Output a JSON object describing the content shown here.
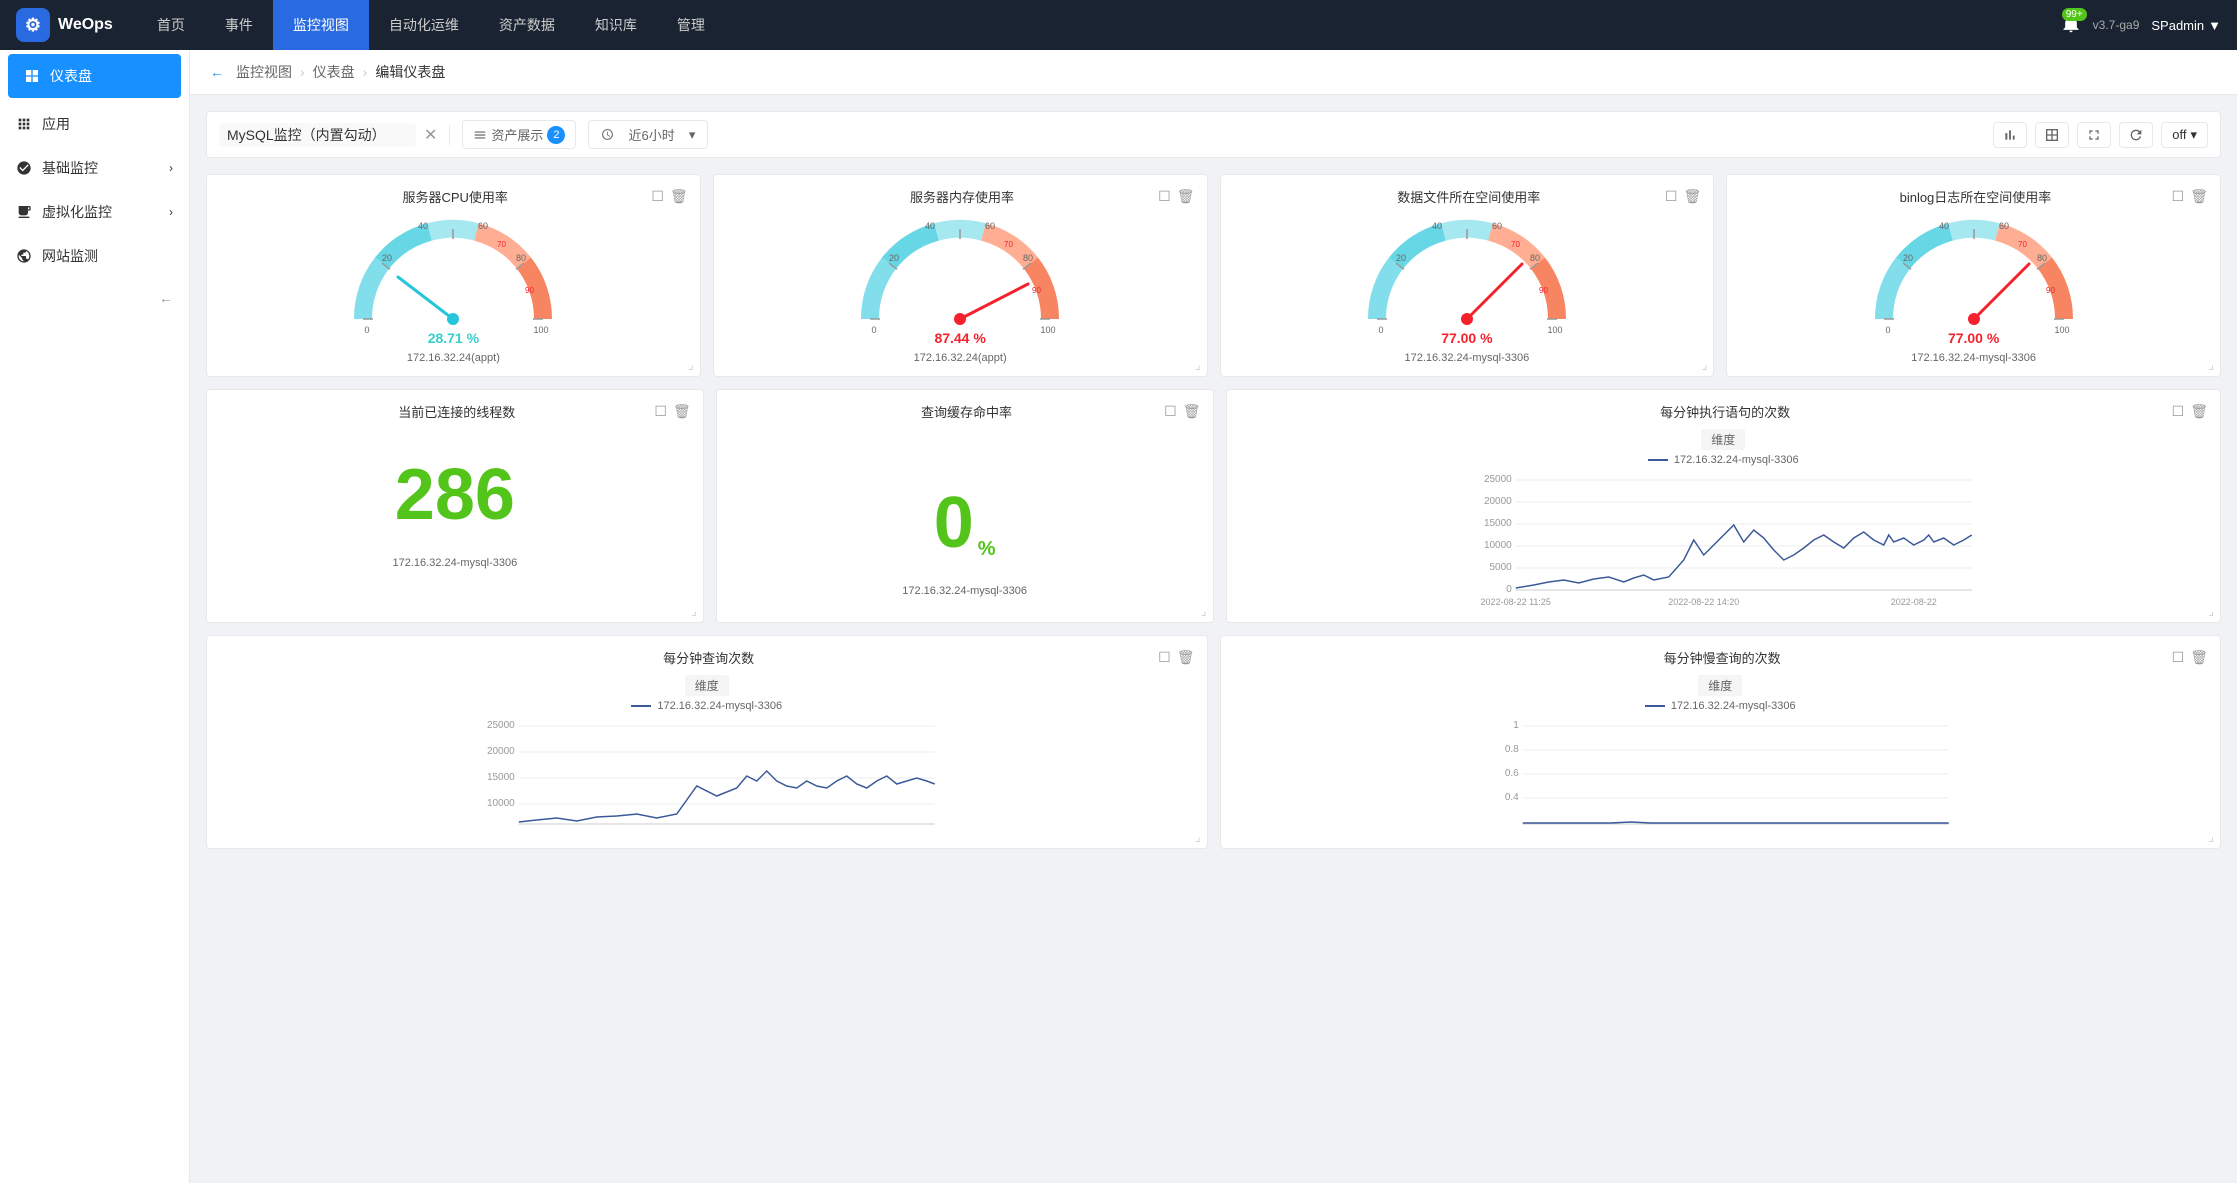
{
  "app": {
    "name": "WeOps",
    "version": "v3.7-ga9",
    "user": "SPadmin",
    "notification_count": "99+"
  },
  "nav": {
    "items": [
      {
        "label": "首页",
        "active": false
      },
      {
        "label": "事件",
        "active": false
      },
      {
        "label": "监控视图",
        "active": true
      },
      {
        "label": "自动化运维",
        "active": false
      },
      {
        "label": "资产数据",
        "active": false
      },
      {
        "label": "知识库",
        "active": false
      },
      {
        "label": "管理",
        "active": false
      }
    ]
  },
  "sidebar": {
    "items": [
      {
        "label": "仪表盘",
        "icon": "dashboard",
        "active": true
      },
      {
        "label": "应用",
        "icon": "app",
        "active": false
      },
      {
        "label": "基础监控",
        "icon": "monitor",
        "active": false,
        "has_children": true
      },
      {
        "label": "虚拟化监控",
        "icon": "virtual",
        "active": false,
        "has_children": true
      },
      {
        "label": "网站监测",
        "icon": "website",
        "active": false
      }
    ]
  },
  "breadcrumb": {
    "items": [
      "监控视图",
      "仪表盘",
      "编辑仪表盘"
    ]
  },
  "toolbar": {
    "dashboard_name": "MySQL监控（内置勾动）",
    "asset_label": "资产展示",
    "asset_count": "2",
    "time_range": "近6小时",
    "off_label": "off"
  },
  "widgets": {
    "row1": [
      {
        "title": "服务器CPU使用率",
        "type": "gauge",
        "value": "28.71 %",
        "value_color": "cyan",
        "server": "172.16.32.24(appt)",
        "gauge_pct": 28.71
      },
      {
        "title": "服务器内存使用率",
        "type": "gauge",
        "value": "87.44 %",
        "value_color": "red",
        "server": "172.16.32.24(appt)",
        "gauge_pct": 87.44
      },
      {
        "title": "数据文件所在空间使用率",
        "type": "gauge",
        "value": "77.00 %",
        "value_color": "red",
        "server": "172.16.32.24-mysql-3306",
        "gauge_pct": 77.0
      },
      {
        "title": "binlog日志所在空间使用率",
        "type": "gauge",
        "value": "77.00 %",
        "value_color": "red",
        "server": "172.16.32.24-mysql-3306",
        "gauge_pct": 77.0
      }
    ],
    "row2": [
      {
        "title": "当前已连接的线程数",
        "type": "big_number",
        "value": "286",
        "server": "172.16.32.24-mysql-3306"
      },
      {
        "title": "查询缓存命中率",
        "type": "big_number_pct",
        "value": "0",
        "unit": "%",
        "server": "172.16.32.24-mysql-3306"
      },
      {
        "title": "每分钟执行语句的次数",
        "type": "line_chart",
        "dimension": "维度",
        "legend": "172.16.32.24-mysql-3306",
        "y_max": 25000,
        "y_labels": [
          "25000",
          "20000",
          "15000",
          "10000",
          "5000",
          "0"
        ],
        "x_labels": [
          "2022-08-22 11:25",
          "2022-08-22 14:20",
          "2022-08-22"
        ],
        "server": ""
      }
    ],
    "row3": [
      {
        "title": "每分钟查询次数",
        "type": "line_chart",
        "dimension": "维度",
        "legend": "172.16.32.24-mysql-3306",
        "y_max": 25000,
        "y_labels": [
          "25000",
          "20000",
          "15000",
          "10000"
        ],
        "x_labels": [],
        "server": ""
      },
      {
        "title": "每分钟慢查询的次数",
        "type": "line_chart",
        "dimension": "维度",
        "legend": "172.16.32.24-mysql-3306",
        "y_max": 1,
        "y_labels": [
          "1",
          "0.8",
          "0.6",
          "0.4"
        ],
        "x_labels": [],
        "server": ""
      }
    ]
  }
}
